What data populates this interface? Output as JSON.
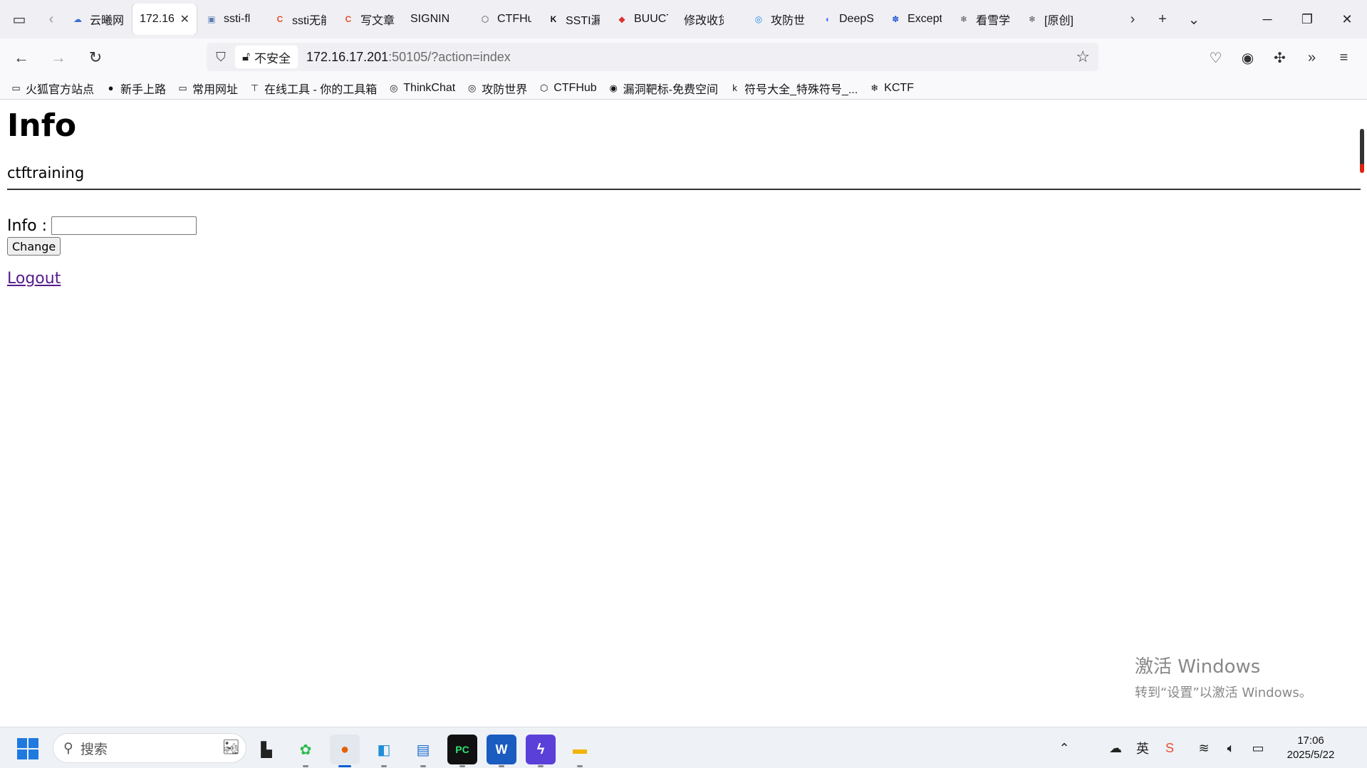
{
  "browser": {
    "tabs": [
      {
        "label": "云曦网",
        "icon": "cloud-icon",
        "color": "#3a6fd8"
      },
      {
        "label": "172.16.",
        "active": true
      },
      {
        "label": "ssti-fl",
        "icon": "page-icon",
        "color": "#5b7fb0"
      },
      {
        "label": "ssti无能",
        "icon": "csdn-icon",
        "color": "#e8502a"
      },
      {
        "label": "写文章",
        "icon": "csdn-icon",
        "color": "#e8502a"
      },
      {
        "label": "SIGNIN",
        "icon": "",
        "color": ""
      },
      {
        "label": "CTFHub",
        "icon": "cube-icon",
        "color": "#444"
      },
      {
        "label": "SSTI漏",
        "icon": "k-icon",
        "color": "#111"
      },
      {
        "label": "BUUCTF",
        "icon": "bu-icon",
        "color": "#d33"
      },
      {
        "label": "修改收货地",
        "icon": "",
        "color": ""
      },
      {
        "label": "攻防世界",
        "icon": "globe-icon",
        "color": "#1e88e5"
      },
      {
        "label": "DeepSeek",
        "icon": "whale-icon",
        "color": "#4d6bfe"
      },
      {
        "label": "Exception",
        "icon": "paw-icon",
        "color": "#2a5bd7"
      },
      {
        "label": "看雪学",
        "icon": "snowflake-icon",
        "color": "#555"
      },
      {
        "label": "[原创]",
        "icon": "snowflake-icon",
        "color": "#555"
      }
    ],
    "url_insecure_label": "不安全",
    "url_host": "172.16.17.201",
    "url_rest": ":50105/?action=index",
    "bookmarks": [
      {
        "label": "火狐官方站点",
        "icon": "folder-icon"
      },
      {
        "label": "新手上路",
        "icon": "firefox-icon"
      },
      {
        "label": "常用网址",
        "icon": "folder-icon"
      },
      {
        "label": "在线工具 - 你的工具箱",
        "icon": "tool-icon"
      },
      {
        "label": "ThinkChat",
        "icon": "globe-icon"
      },
      {
        "label": "攻防世界",
        "icon": "globe-icon"
      },
      {
        "label": "CTFHub",
        "icon": "cube-icon"
      },
      {
        "label": "漏洞靶标-免费空间",
        "icon": "target-icon"
      },
      {
        "label": "符号大全_特殊符号_...",
        "icon": "ke-icon"
      },
      {
        "label": "KCTF",
        "icon": "snowflake-icon"
      }
    ]
  },
  "page": {
    "title": "Info",
    "subtitle": "ctftraining",
    "info_label": "Info :",
    "info_value": "",
    "change_button": "Change",
    "logout_link": "Logout"
  },
  "watermark": {
    "line1": "激活 Windows",
    "line2": "转到“设置”以激活 Windows。"
  },
  "taskbar": {
    "search_placeholder": "搜索",
    "time": "17:06",
    "date": "2025/5/22"
  }
}
